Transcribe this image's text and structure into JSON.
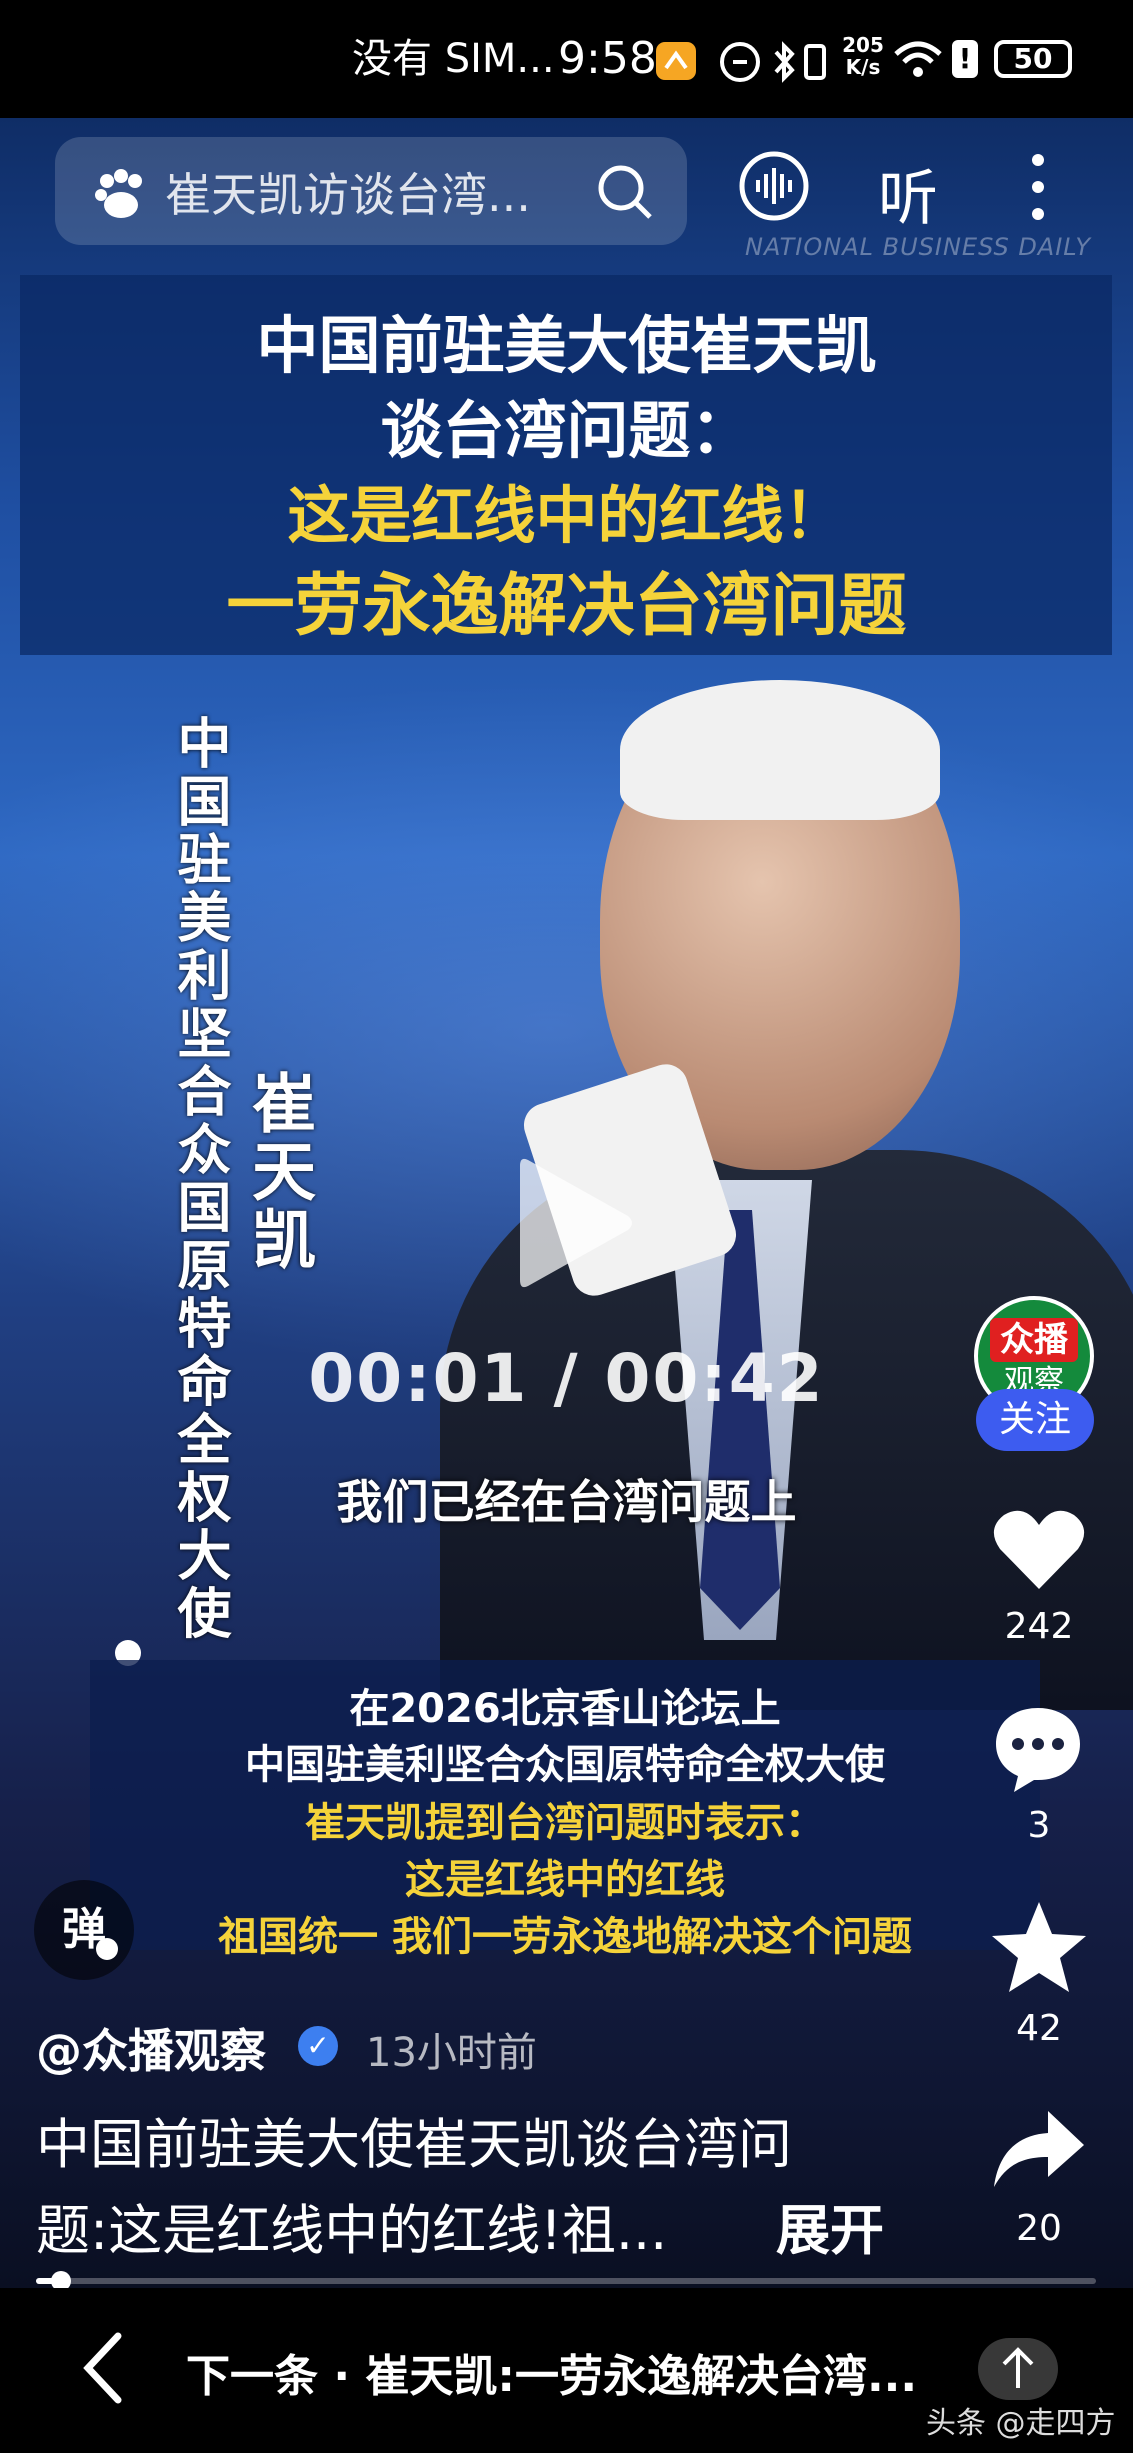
{
  "status_bar": {
    "carrier": "没有 SIM...",
    "time": "9:58",
    "net_speed_value": "205",
    "net_speed_unit": "K/s",
    "battery": "50"
  },
  "top": {
    "search_text": "崔天凯访谈台湾...",
    "listen_label": "听",
    "watermark": "NATIONAL BUSINESS DAILY"
  },
  "video": {
    "headline_line1": "中国前驻美大使崔天凯",
    "headline_line2": "谈台湾问题：",
    "headline_line3": "这是红线中的红线！",
    "headline_line4": "一劳永逸解决台湾问题",
    "side_title": "中国驻美利坚合众国原特命全权大使",
    "side_name": "崔天凯",
    "timer": "00:01 / 00:42",
    "caption": "我们已经在台湾问题上",
    "sub_line1": "在2026北京香山论坛上",
    "sub_line2": "中国驻美利坚合众国原特命全权大使",
    "sub_line3": "崔天凯提到台湾问题时表示：",
    "sub_line4": "这是红线中的红线",
    "sub_line5": "祖国统一 我们一劳永逸地解决这个问题",
    "progress_fraction": 0.024
  },
  "rail": {
    "avatar_text_top": "众播",
    "avatar_text_bottom": "观察",
    "follow_label": "关注",
    "like_count": "242",
    "comment_count": "3",
    "favorite_count": "42",
    "share_count": "20"
  },
  "post": {
    "danmaku_label": "弹",
    "author": "@众播观察",
    "time_ago": "13小时前",
    "desc_line1": "中国前驻美大使崔天凯谈台湾问",
    "desc_line2": "题:这是红线中的红线!祖...",
    "expand_label": "展开"
  },
  "bottom_bar": {
    "next_label": "下一条 · 崔天凯:一劳永逸解决台湾...",
    "footer_brand": "头条 @走四方"
  },
  "colors": {
    "accent_yellow": "#f5d33a",
    "follow_blue": "#3d5cf0",
    "avatar_green": "#148a3c",
    "avatar_red": "#e02020"
  }
}
